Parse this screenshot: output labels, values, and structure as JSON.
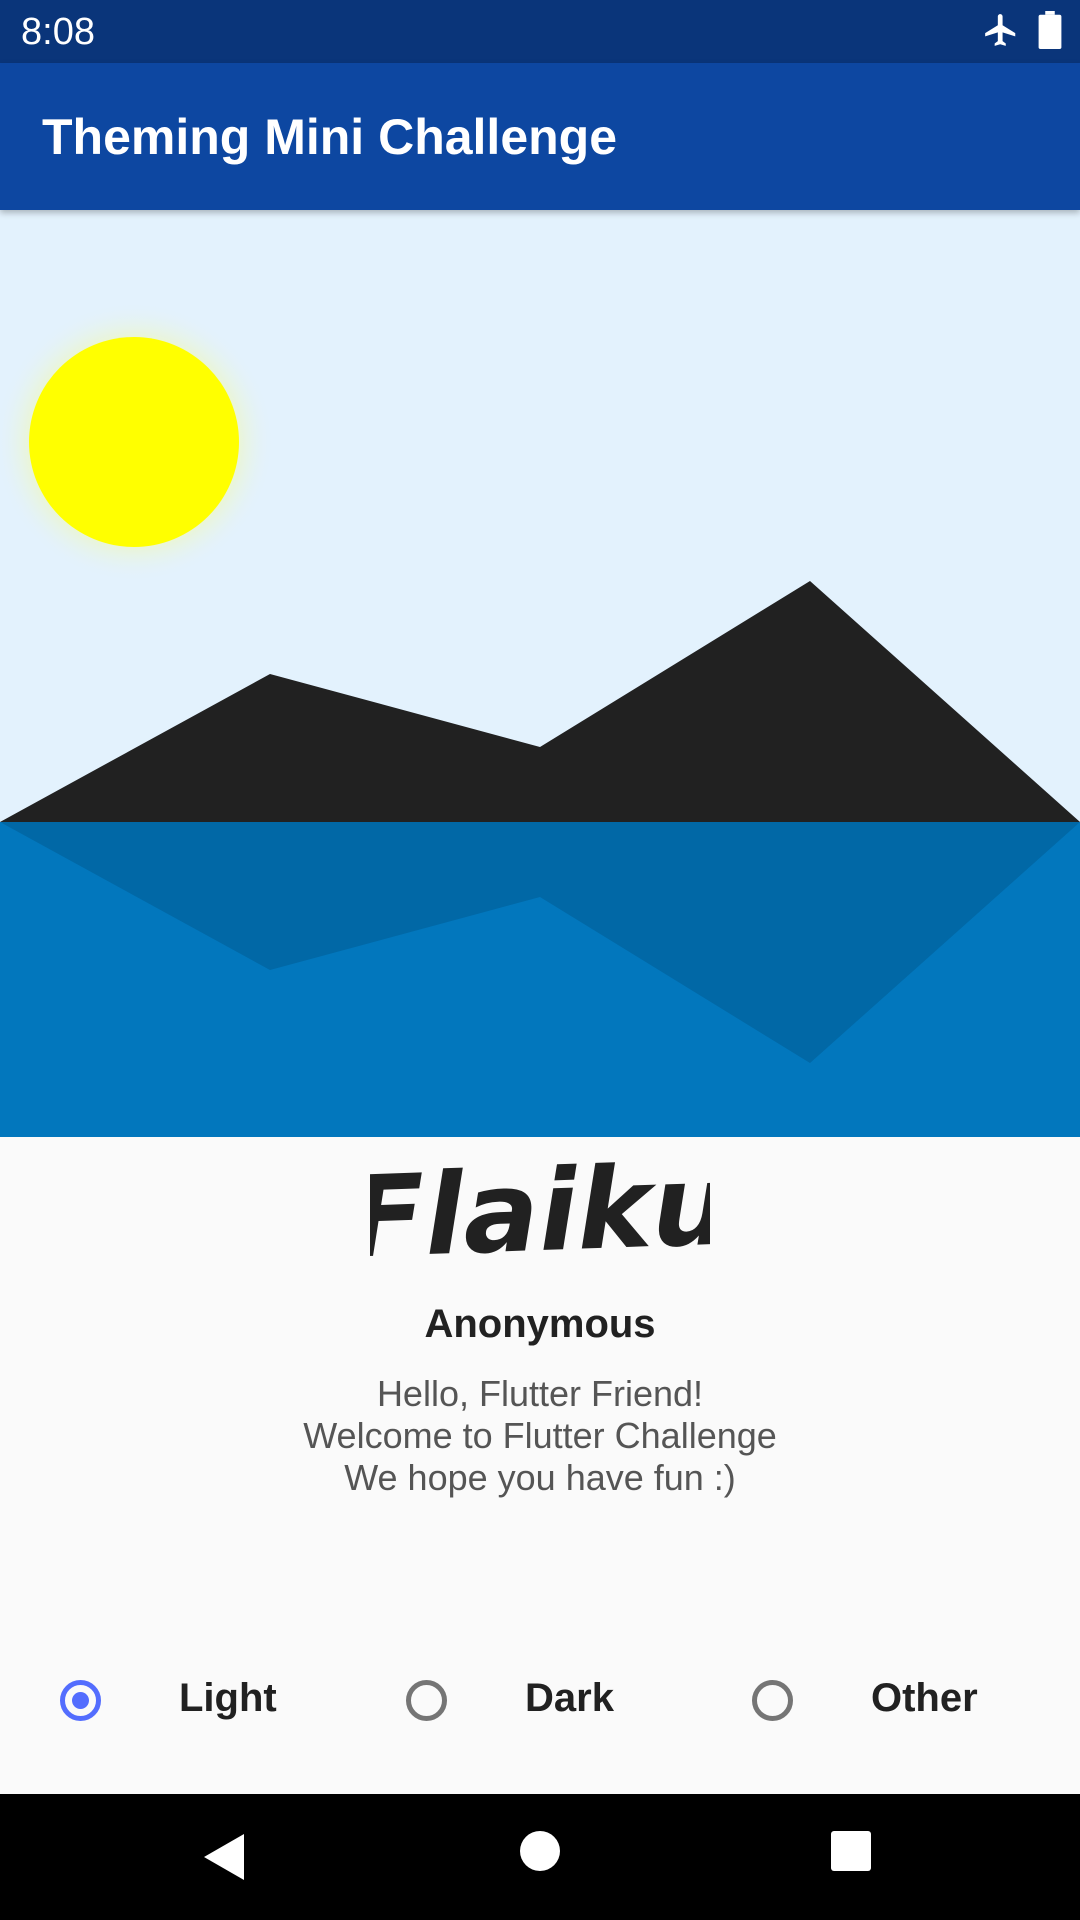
{
  "status_bar": {
    "time": "8:08",
    "icons": [
      "airplane-mode-icon",
      "battery-icon"
    ]
  },
  "app_bar": {
    "title": "Theming Mini Challenge",
    "color": "#0d47a1"
  },
  "scene": {
    "sky_color": "#e3f2fd",
    "sun_color": "#ffff00",
    "mountain_color": "#212121",
    "water_color": "#0277bd",
    "reflection_color": "#0168a6"
  },
  "content": {
    "logo": "Flaiku",
    "author": "Anonymous",
    "message_lines": [
      "Hello, Flutter Friend!",
      "Welcome to Flutter Challenge",
      "We hope you have fun :)"
    ]
  },
  "theme_options": {
    "selected": "Light",
    "options": [
      "Light",
      "Dark",
      "Other"
    ],
    "accent_color": "#536dfe"
  },
  "nav_bar": {
    "icons": [
      "back-icon",
      "home-icon",
      "recents-icon"
    ]
  }
}
